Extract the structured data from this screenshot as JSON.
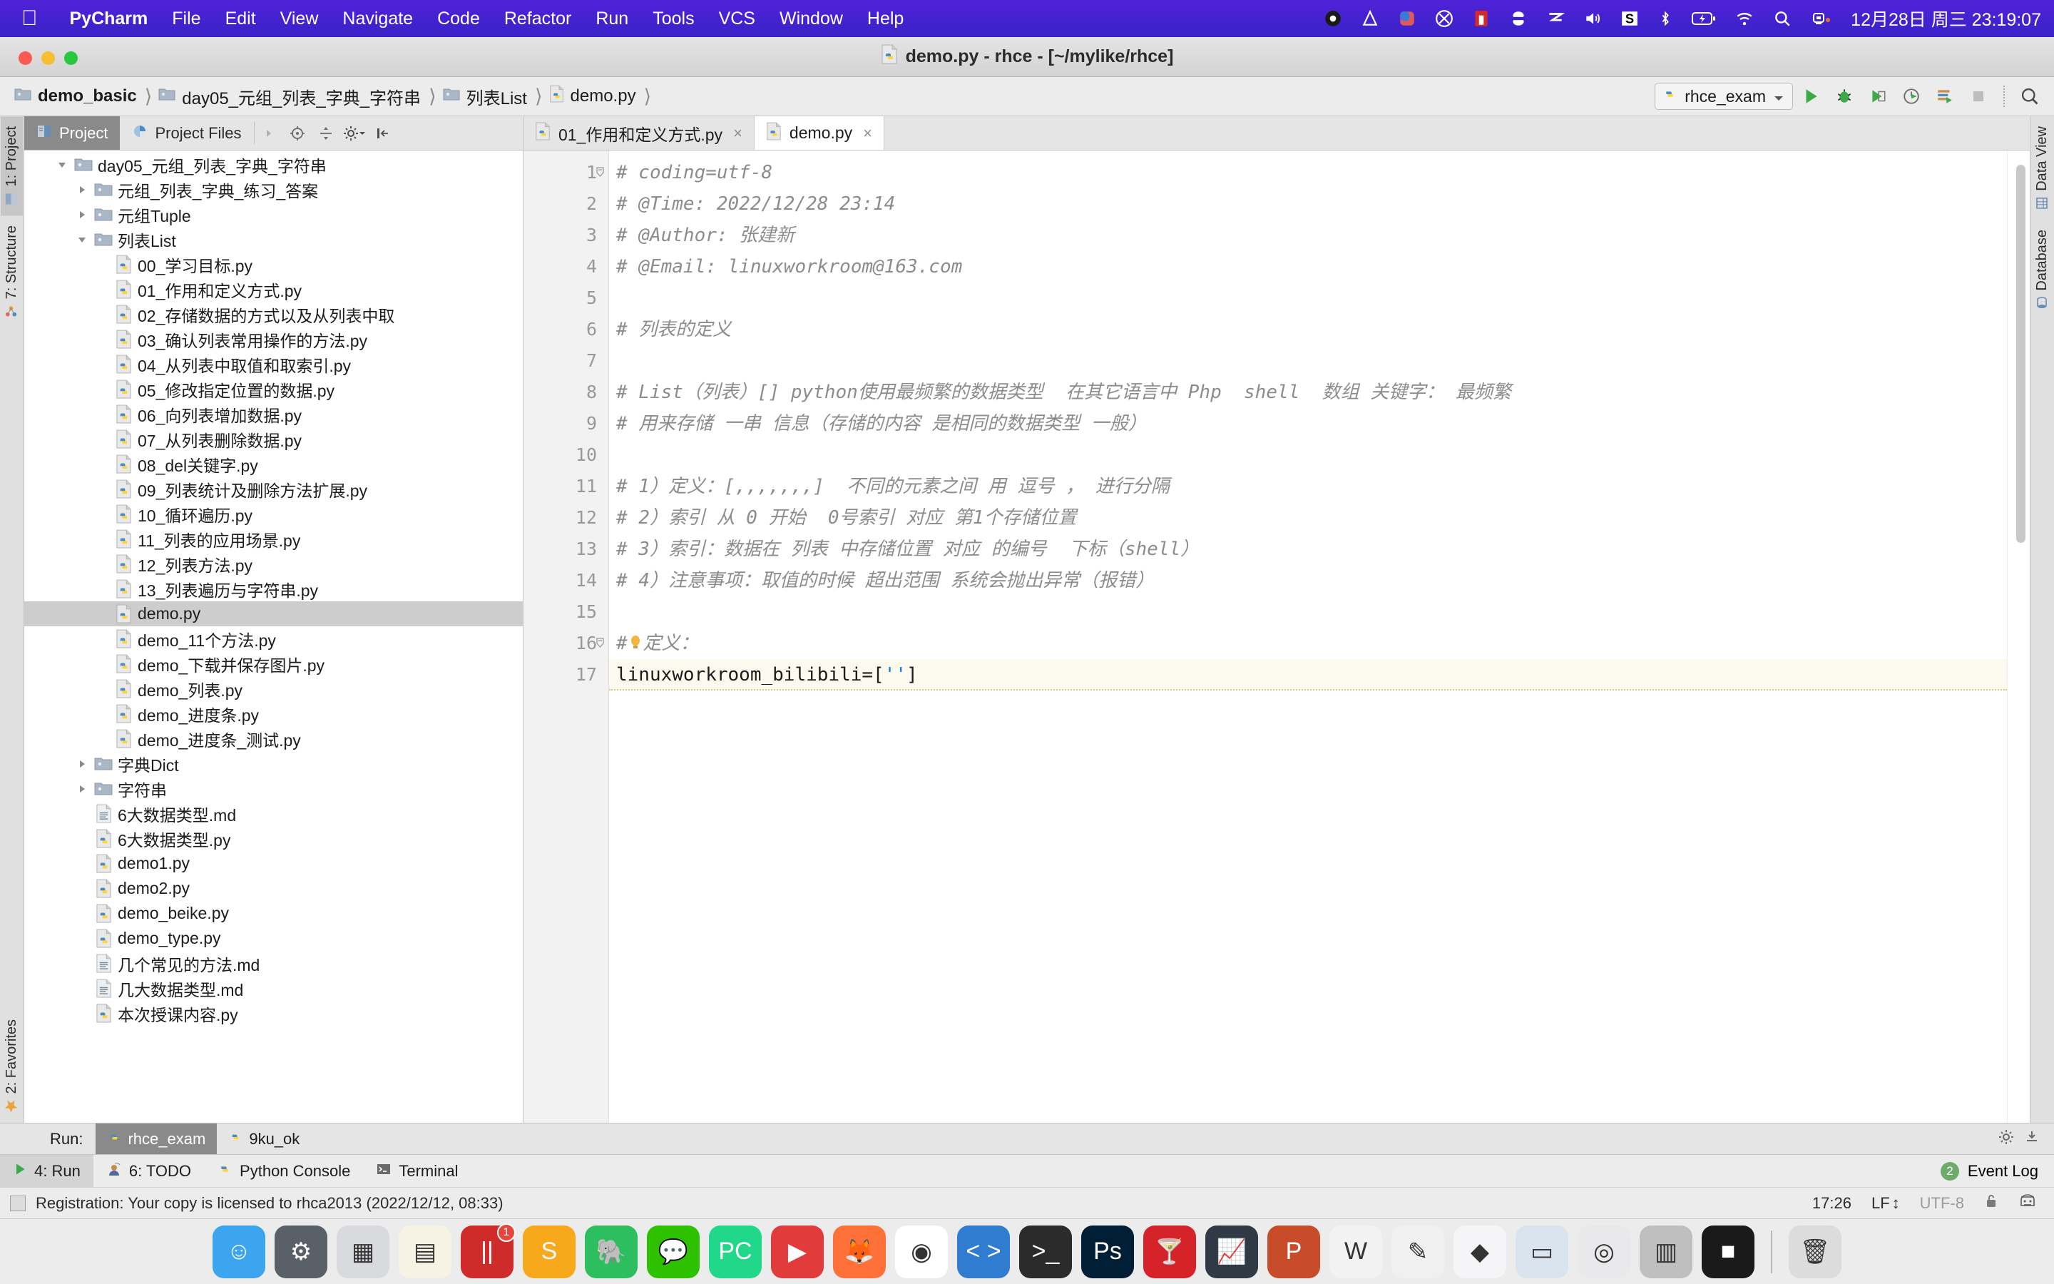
{
  "menubar": {
    "apple_icon": "apple-icon",
    "items": [
      "PyCharm",
      "File",
      "Edit",
      "View",
      "Navigate",
      "Code",
      "Refactor",
      "Run",
      "Tools",
      "VCS",
      "Window",
      "Help"
    ],
    "status_icons": [
      "record-icon",
      "tunnelblick-icon",
      "cleanmymac-icon",
      "bartender-icon",
      "parallels-icon",
      "battery-sensor-icon",
      "shortcuts-icon",
      "volume-icon",
      "sogou-input-icon",
      "bluetooth-icon",
      "battery-bolt-icon",
      "wifi-icon",
      "spotlight-search-icon",
      "control-center-icon"
    ],
    "clock": "12月28日 周三  23:19:07"
  },
  "window": {
    "title": "demo.py - rhce - [~/mylike/rhce]",
    "title_icon": "python-file-icon"
  },
  "breadcrumbs": [
    {
      "label": "demo_basic",
      "icon": "folder-icon"
    },
    {
      "label": "day05_元组_列表_字典_字符串",
      "icon": "folder-icon"
    },
    {
      "label": "列表List",
      "icon": "folder-icon"
    },
    {
      "label": "demo.py",
      "icon": "python-file-icon"
    }
  ],
  "toolbar": {
    "run_config": "rhce_exam",
    "run_config_icon": "python-icon",
    "dropdown_icon": "chevron-down-icon",
    "buttons": [
      "run-icon",
      "debug-icon",
      "coverage-icon",
      "profile-icon",
      "run-with-console-icon",
      "stop-icon",
      "search-everywhere-icon"
    ]
  },
  "left_strip": {
    "tabs": [
      {
        "label": "1: Project",
        "num": "1",
        "icon": "project-icon",
        "active": true
      },
      {
        "label": "7: Structure",
        "num": "7",
        "icon": "structure-icon",
        "active": false
      }
    ],
    "bottom_tabs": [
      {
        "label": "2: Favorites",
        "num": "2",
        "icon": "favorites-star-icon"
      }
    ]
  },
  "right_strip": {
    "tabs": [
      {
        "label": "Data View",
        "icon": "data-view-icon"
      },
      {
        "label": "Database",
        "icon": "database-icon"
      }
    ]
  },
  "project_panel": {
    "tabs": [
      {
        "label": "Project",
        "icon": "project-icon",
        "active": true
      },
      {
        "label": "Project Files",
        "icon": "pie-icon",
        "active": false
      }
    ],
    "tools": [
      "expand-arrow-icon",
      "target-icon",
      "collapse-all-icon",
      "gear-icon",
      "hide-icon"
    ],
    "tree": [
      {
        "label": "day05_元组_列表_字典_字符串",
        "indent": 1,
        "twisty": "down",
        "icon": "folder-icon",
        "selected": false,
        "clipped": true
      },
      {
        "label": "元组_列表_字典_练习_答案",
        "indent": 2,
        "twisty": "right",
        "icon": "folder-icon",
        "selected": false
      },
      {
        "label": "元组Tuple",
        "indent": 2,
        "twisty": "right",
        "icon": "folder-icon",
        "selected": false
      },
      {
        "label": "列表List",
        "indent": 2,
        "twisty": "down",
        "icon": "folder-icon",
        "selected": false
      },
      {
        "label": "00_学习目标.py",
        "indent": 3,
        "twisty": "",
        "icon": "python-file-icon",
        "selected": false
      },
      {
        "label": "01_作用和定义方式.py",
        "indent": 3,
        "twisty": "",
        "icon": "python-file-icon",
        "selected": false
      },
      {
        "label": "02_存储数据的方式以及从列表中取",
        "indent": 3,
        "twisty": "",
        "icon": "python-file-icon",
        "selected": false
      },
      {
        "label": "03_确认列表常用操作的方法.py",
        "indent": 3,
        "twisty": "",
        "icon": "python-file-icon",
        "selected": false
      },
      {
        "label": "04_从列表中取值和取索引.py",
        "indent": 3,
        "twisty": "",
        "icon": "python-file-icon",
        "selected": false
      },
      {
        "label": "05_修改指定位置的数据.py",
        "indent": 3,
        "twisty": "",
        "icon": "python-file-icon",
        "selected": false
      },
      {
        "label": "06_向列表增加数据.py",
        "indent": 3,
        "twisty": "",
        "icon": "python-file-icon",
        "selected": false
      },
      {
        "label": "07_从列表删除数据.py",
        "indent": 3,
        "twisty": "",
        "icon": "python-file-icon",
        "selected": false
      },
      {
        "label": "08_del关键字.py",
        "indent": 3,
        "twisty": "",
        "icon": "python-file-icon",
        "selected": false
      },
      {
        "label": "09_列表统计及删除方法扩展.py",
        "indent": 3,
        "twisty": "",
        "icon": "python-file-icon",
        "selected": false
      },
      {
        "label": "10_循环遍历.py",
        "indent": 3,
        "twisty": "",
        "icon": "python-file-icon",
        "selected": false
      },
      {
        "label": "11_列表的应用场景.py",
        "indent": 3,
        "twisty": "",
        "icon": "python-file-icon",
        "selected": false
      },
      {
        "label": "12_列表方法.py",
        "indent": 3,
        "twisty": "",
        "icon": "python-file-icon",
        "selected": false
      },
      {
        "label": "13_列表遍历与字符串.py",
        "indent": 3,
        "twisty": "",
        "icon": "python-file-icon",
        "selected": false
      },
      {
        "label": "demo.py",
        "indent": 3,
        "twisty": "",
        "icon": "python-file-icon",
        "selected": true
      },
      {
        "label": "demo_11个方法.py",
        "indent": 3,
        "twisty": "",
        "icon": "python-file-icon",
        "selected": false
      },
      {
        "label": "demo_下载并保存图片.py",
        "indent": 3,
        "twisty": "",
        "icon": "python-file-icon",
        "selected": false
      },
      {
        "label": "demo_列表.py",
        "indent": 3,
        "twisty": "",
        "icon": "python-file-icon",
        "selected": false
      },
      {
        "label": "demo_进度条.py",
        "indent": 3,
        "twisty": "",
        "icon": "python-file-icon",
        "selected": false
      },
      {
        "label": "demo_进度条_测试.py",
        "indent": 3,
        "twisty": "",
        "icon": "python-file-icon",
        "selected": false
      },
      {
        "label": "字典Dict",
        "indent": 2,
        "twisty": "right",
        "icon": "folder-icon",
        "selected": false
      },
      {
        "label": "字符串",
        "indent": 2,
        "twisty": "right",
        "icon": "folder-icon",
        "selected": false
      },
      {
        "label": "6大数据类型.md",
        "indent": 2,
        "twisty": "",
        "icon": "markdown-file-icon",
        "selected": false
      },
      {
        "label": "6大数据类型.py",
        "indent": 2,
        "twisty": "",
        "icon": "python-file-icon",
        "selected": false
      },
      {
        "label": "demo1.py",
        "indent": 2,
        "twisty": "",
        "icon": "python-file-icon",
        "selected": false
      },
      {
        "label": "demo2.py",
        "indent": 2,
        "twisty": "",
        "icon": "python-file-icon",
        "selected": false
      },
      {
        "label": "demo_beike.py",
        "indent": 2,
        "twisty": "",
        "icon": "python-file-icon",
        "selected": false
      },
      {
        "label": "demo_type.py",
        "indent": 2,
        "twisty": "",
        "icon": "python-file-icon",
        "selected": false
      },
      {
        "label": "几个常见的方法.md",
        "indent": 2,
        "twisty": "",
        "icon": "markdown-file-icon",
        "selected": false
      },
      {
        "label": "几大数据类型.md",
        "indent": 2,
        "twisty": "",
        "icon": "markdown-file-icon",
        "selected": false
      },
      {
        "label": "本次授课内容.py",
        "indent": 2,
        "twisty": "",
        "icon": "python-file-icon",
        "selected": false
      }
    ]
  },
  "editor": {
    "tabs": [
      {
        "label": "01_作用和定义方式.py",
        "icon": "python-file-icon",
        "active": false,
        "close": "×"
      },
      {
        "label": "demo.py",
        "icon": "python-file-icon",
        "active": true,
        "close": "×"
      }
    ],
    "lines": [
      {
        "n": "1",
        "text": "# coding=utf-8",
        "type": "comment",
        "fold": true
      },
      {
        "n": "2",
        "text": "# @Time: 2022/12/28 23:14",
        "type": "comment"
      },
      {
        "n": "3",
        "text": "# @Author: 张建新",
        "type": "comment"
      },
      {
        "n": "4",
        "text": "# @Email: linuxworkroom@163.com",
        "type": "comment"
      },
      {
        "n": "5",
        "text": "",
        "type": "comment"
      },
      {
        "n": "6",
        "text": "# 列表的定义",
        "type": "comment"
      },
      {
        "n": "7",
        "text": "",
        "type": "comment"
      },
      {
        "n": "8",
        "text": "# List（列表）[] python使用最频繁的数据类型  在其它语言中 Php  shell  数组 关键字： 最频繁",
        "type": "comment"
      },
      {
        "n": "9",
        "text": "# 用来存储 一串 信息（存储的内容 是相同的数据类型 一般）",
        "type": "comment"
      },
      {
        "n": "10",
        "text": "",
        "type": "comment"
      },
      {
        "n": "11",
        "text": "# 1）定义：[,,,,,,,]  不同的元素之间 用 逗号 ， 进行分隔",
        "type": "comment"
      },
      {
        "n": "12",
        "text": "# 2）索引 从 0 开始  0号索引 对应 第1个存储位置",
        "type": "comment"
      },
      {
        "n": "13",
        "text": "# 3）索引：数据在 列表 中存储位置 对应 的编号  下标（shell）",
        "type": "comment"
      },
      {
        "n": "14",
        "text": "# 4）注意事项：取值的时候 超出范围 系统会抛出异常（报错）",
        "type": "comment"
      },
      {
        "n": "15",
        "text": "",
        "type": "comment"
      },
      {
        "n": "16",
        "text": "#定义：",
        "type": "comment",
        "fold": true,
        "bulb": true
      },
      {
        "n": "17",
        "text": "linuxworkroom_bilibili=['']",
        "type": "code",
        "current": true
      }
    ]
  },
  "run_window": {
    "label": "Run:",
    "tabs": [
      {
        "label": "rhce_exam",
        "icon": "python-icon",
        "active": true
      },
      {
        "label": "9ku_ok",
        "icon": "python-icon",
        "active": false
      }
    ],
    "tools": [
      "gear-icon",
      "hide-icon"
    ]
  },
  "bottom_bar": {
    "tabs": [
      {
        "label": "4: Run",
        "num": "4",
        "icon": "run-green-icon",
        "active": true
      },
      {
        "label": "6: TODO",
        "num": "6",
        "icon": "todo-icon",
        "active": false
      },
      {
        "label": "Python Console",
        "num": "",
        "icon": "python-icon",
        "active": false
      },
      {
        "label": "Terminal",
        "num": "",
        "icon": "terminal-icon",
        "active": false
      }
    ],
    "event_log": {
      "label": "Event Log",
      "count": "2"
    }
  },
  "status_bar": {
    "message": "Registration: Your copy is licensed to rhca2013 (2022/12/12, 08:33)",
    "caret": "17:26",
    "line_separator": "LF",
    "encoding": "UTF-8",
    "lock_icon": "lock-icon",
    "inspector_icon": "inspection-face-icon"
  },
  "dock": {
    "items": [
      {
        "name": "finder",
        "glyph": "☺",
        "bg": "#3ca5f0",
        "badge": ""
      },
      {
        "name": "system-preferences",
        "glyph": "⚙",
        "bg": "#5a6068",
        "badge": ""
      },
      {
        "name": "launchpad",
        "glyph": "▦",
        "bg": "#d8dadd",
        "badge": ""
      },
      {
        "name": "notes",
        "glyph": "▤",
        "bg": "#f6f2e4",
        "badge": ""
      },
      {
        "name": "parallels",
        "glyph": "||",
        "bg": "#cf2b2b",
        "badge": "1"
      },
      {
        "name": "sublime-text",
        "glyph": "S",
        "bg": "#f7a81b",
        "badge": ""
      },
      {
        "name": "evernote",
        "glyph": "🐘",
        "bg": "#2dbe60",
        "badge": ""
      },
      {
        "name": "wechat",
        "glyph": "💬",
        "bg": "#2dc100",
        "badge": ""
      },
      {
        "name": "pycharm",
        "glyph": "PC",
        "bg": "#21d789",
        "badge": ""
      },
      {
        "name": "iina",
        "glyph": "▶",
        "bg": "#e23b3b",
        "badge": ""
      },
      {
        "name": "firefox",
        "glyph": "🦊",
        "bg": "#ff7139",
        "badge": ""
      },
      {
        "name": "chrome",
        "glyph": "◉",
        "bg": "#ffffff",
        "badge": ""
      },
      {
        "name": "vscode",
        "glyph": "< >",
        "bg": "#2f7cd1",
        "badge": ""
      },
      {
        "name": "terminal",
        "glyph": ">_",
        "bg": "#2b2b2b",
        "badge": ""
      },
      {
        "name": "photoshop",
        "glyph": "Ps",
        "bg": "#001e36",
        "badge": ""
      },
      {
        "name": "handbrake",
        "glyph": "🍸",
        "bg": "#d6232a",
        "badge": ""
      },
      {
        "name": "activity-monitor",
        "glyph": "📈",
        "bg": "#2f3a45",
        "badge": ""
      },
      {
        "name": "powerpoint",
        "glyph": "P",
        "bg": "#c84c2a",
        "badge": ""
      },
      {
        "name": "word",
        "glyph": "W",
        "bg": "#f2f2f2",
        "badge": ""
      },
      {
        "name": "markdown-editor",
        "glyph": "✎",
        "bg": "#f0f0f0",
        "badge": ""
      },
      {
        "name": "cleanmymac",
        "glyph": "◆",
        "bg": "#f5f5f7",
        "badge": ""
      },
      {
        "name": "screenshot-tool",
        "glyph": "▭",
        "bg": "#d9e4ef",
        "badge": ""
      },
      {
        "name": "preview",
        "glyph": "◎",
        "bg": "#e9e9ec",
        "badge": ""
      },
      {
        "name": "stack-window",
        "glyph": "▥",
        "bg": "#bfbfbf",
        "badge": ""
      },
      {
        "name": "dark-window",
        "glyph": "■",
        "bg": "#1a1a1a",
        "badge": ""
      },
      {
        "name": "trash",
        "glyph": "🗑",
        "bg": "#dcdcdc",
        "badge": ""
      }
    ]
  }
}
